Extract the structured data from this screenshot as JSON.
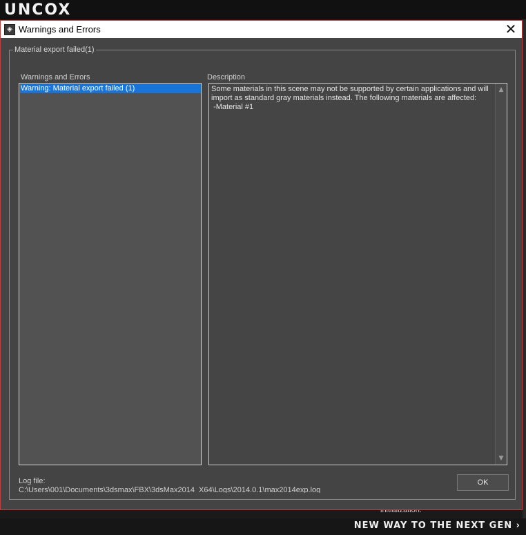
{
  "background": {
    "logo": "UNCOX",
    "tagline": "NEW WAY TO THE NEXT GEN ›",
    "status": "initialization."
  },
  "dialog": {
    "title": "Warnings and Errors",
    "close": "✕",
    "group_title": "Material export failed(1)",
    "list_label": "Warnings and Errors",
    "description_label": "Description",
    "list_items": [
      "Warning: Material export failed (1)"
    ],
    "description": "Some materials in this scene may not be supported by certain applications and will import as standard gray materials instead. The following materials are affected:\n -Material #1",
    "log_label": "Log file:",
    "log_path": "C:\\Users\\001\\Documents\\3dsmax\\FBX\\3dsMax2014_X64\\Logs\\2014.0.1\\max2014exp.log",
    "ok": "OK"
  },
  "colors": {
    "dialog_bg": "#444444",
    "selection": "#1874d8",
    "border_accent": "#c04040"
  }
}
